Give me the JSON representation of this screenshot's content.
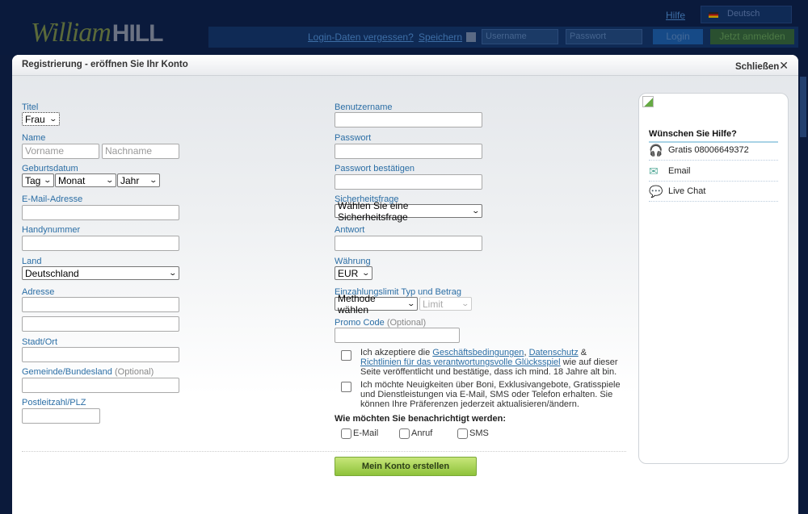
{
  "header": {
    "logo_script": "William",
    "logo_bold": "HILL",
    "help": "Hilfe",
    "language": "Deutsch",
    "forgot": "Login-Daten vergessen?",
    "remember": "Speichern",
    "username_placeholder": "Username",
    "password_placeholder": "Passwort",
    "login": "Login",
    "join": "Jetzt anmelden"
  },
  "modal": {
    "title": "Registrierung - eröffnen Sie Ihr Konto",
    "close": "Schließen",
    "close_icon": "close-x"
  },
  "left": {
    "title_label": "Titel",
    "title_value": "Frau",
    "name_label": "Name",
    "first_placeholder": "Vorname",
    "last_placeholder": "Nachname",
    "dob_label": "Geburtsdatum",
    "day": "Tag",
    "month": "Monat",
    "year": "Jahr",
    "email_label": "E-Mail-Adresse",
    "mobile_label": "Handynummer",
    "country_label": "Land",
    "country_value": "Deutschland",
    "address_label": "Adresse",
    "city_label": "Stadt/Ort",
    "state_label": "Gemeinde/Bundesland",
    "state_optional": "(Optional)",
    "zip_label": "Postleitzahl/PLZ"
  },
  "right": {
    "username_label": "Benutzername",
    "password_label": "Passwort",
    "confirm_label": "Passwort bestätigen",
    "question_label": "Sicherheitsfrage",
    "question_value": "Wählen Sie eine Sicherheitsfrage",
    "answer_label": "Antwort",
    "currency_label": "Währung",
    "currency_value": "EUR",
    "limit_label": "Einzahlungslimit Typ und Betrag",
    "limit_method": "Methode wählen",
    "limit_amount": "Limit",
    "promo_label": "Promo Code",
    "promo_optional": "(Optional)",
    "terms_pre": "Ich akzeptiere die ",
    "terms_link1": "Geschäftsbedingungen",
    "terms_sep1": ", ",
    "terms_link2": "Datenschutz",
    "terms_sep2": " & ",
    "terms_link3": "Richtlinien für das verantwortungsvolle Glücksspiel",
    "terms_post": " wie auf dieser Seite veröffentlicht und bestätige, dass ich mind. 18 Jahre alt bin.",
    "news": "Ich möchte Neuigkeiten über Boni, Exklusivangebote, Gratisspiele und Dienstleistungen via E-Mail, SMS oder Telefon erhalten. Sie können Ihre Präferenzen jederzeit aktualisieren/ändern.",
    "notify_label": "Wie möchten Sie benachrichtigt werden:",
    "notify_email": "E-Mail",
    "notify_call": "Anruf",
    "notify_sms": "SMS",
    "submit": "Mein Konto erstellen"
  },
  "help": {
    "title": "Wünschen Sie Hilfe?",
    "phone": "Gratis 08006649372",
    "email": "Email",
    "chat": "Live Chat"
  },
  "colors": {
    "label": "#2b6ea5",
    "submit": "#8ec23a",
    "background": "#0b1a3b"
  }
}
